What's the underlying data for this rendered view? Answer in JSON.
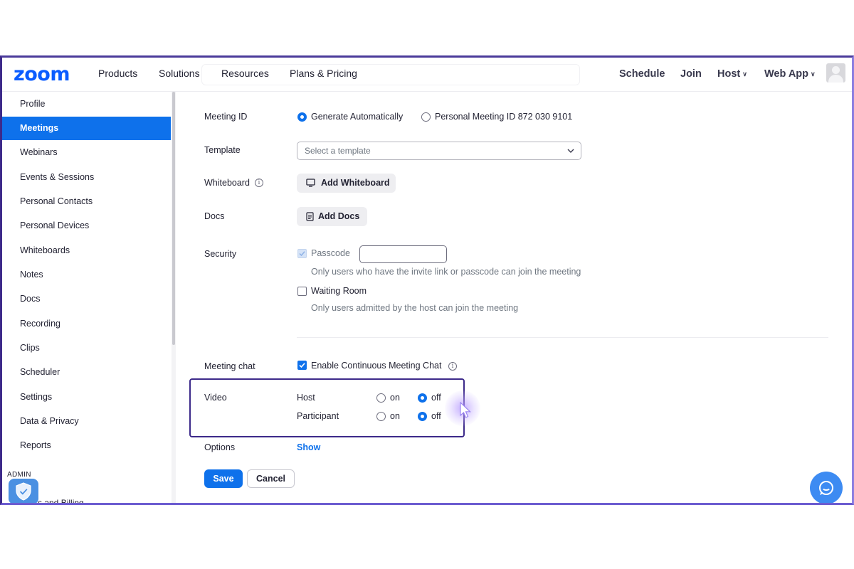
{
  "header": {
    "logo": "zoom",
    "nav": [
      "Products",
      "Solutions",
      "Resources",
      "Plans & Pricing"
    ],
    "right": {
      "schedule": "Schedule",
      "join": "Join",
      "host": "Host",
      "web_app": "Web App"
    }
  },
  "sidebar": {
    "items": [
      {
        "label": "Profile"
      },
      {
        "label": "Meetings",
        "active": true
      },
      {
        "label": "Webinars"
      },
      {
        "label": "Events & Sessions"
      },
      {
        "label": "Personal Contacts"
      },
      {
        "label": "Personal Devices"
      },
      {
        "label": "Whiteboards"
      },
      {
        "label": "Notes"
      },
      {
        "label": "Docs"
      },
      {
        "label": "Recording"
      },
      {
        "label": "Clips"
      },
      {
        "label": "Scheduler"
      },
      {
        "label": "Settings"
      },
      {
        "label": "Data & Privacy"
      },
      {
        "label": "Reports"
      }
    ],
    "admin_label": "ADMIN",
    "billing_label": "s and Billing"
  },
  "form": {
    "meeting_id": {
      "label": "Meeting ID",
      "option_auto": "Generate Automatically",
      "option_personal": "Personal Meeting ID 872 030 9101",
      "selected": "auto"
    },
    "template": {
      "label": "Template",
      "placeholder": "Select a template"
    },
    "whiteboard": {
      "label": "Whiteboard",
      "button": "Add Whiteboard"
    },
    "docs": {
      "label": "Docs",
      "button": "Add Docs"
    },
    "security": {
      "label": "Security",
      "passcode_label": "Passcode",
      "passcode_checked": true,
      "passcode_value": "",
      "passcode_hint": "Only users who have the invite link or passcode can join the meeting",
      "waiting_room_label": "Waiting Room",
      "waiting_room_checked": false,
      "waiting_room_hint": "Only users admitted by the host can join the meeting"
    },
    "meeting_chat": {
      "label": "Meeting chat",
      "option": "Enable Continuous Meeting Chat",
      "checked": true
    },
    "video": {
      "label": "Video",
      "host_label": "Host",
      "participant_label": "Participant",
      "on_label": "on",
      "off_label": "off",
      "host_value": "off",
      "participant_value": "off"
    },
    "options": {
      "label": "Options",
      "link": "Show"
    },
    "save": "Save",
    "cancel": "Cancel"
  },
  "colors": {
    "brand": "#0b5cff",
    "accent": "#0e71eb",
    "highlight_border": "#3d2a8a"
  }
}
